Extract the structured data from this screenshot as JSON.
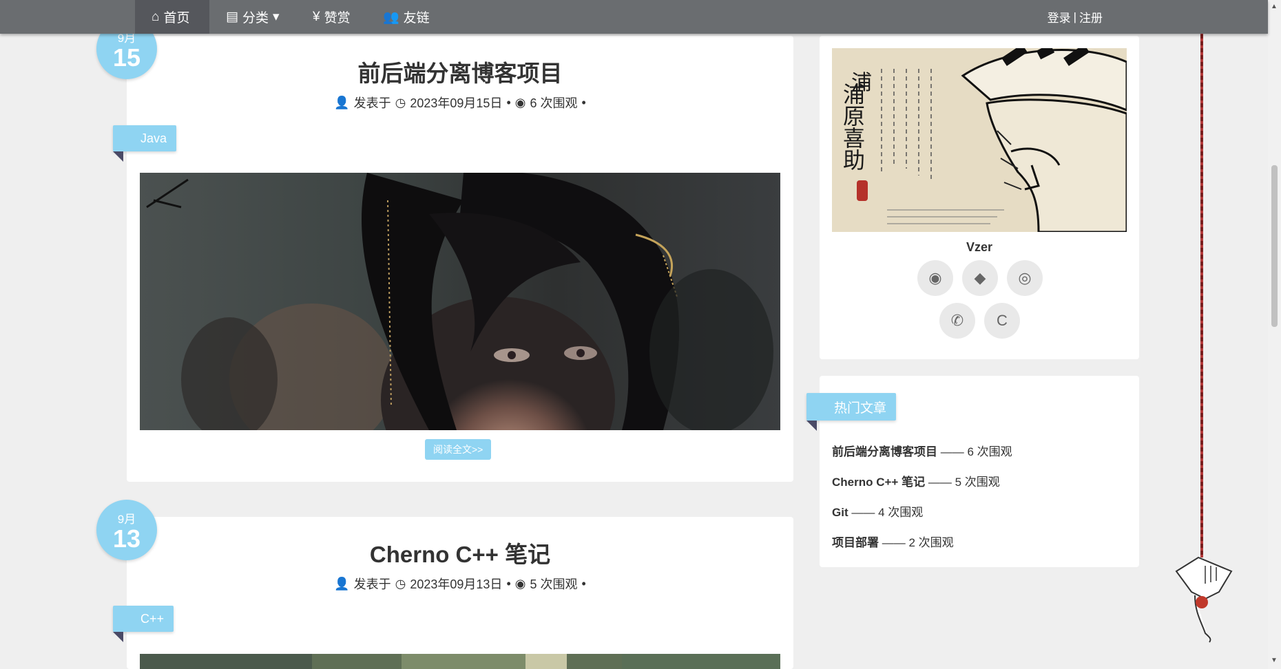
{
  "nav": {
    "items": [
      {
        "icon": "home-icon",
        "glyph": "⌂",
        "label": "首页"
      },
      {
        "icon": "category-icon",
        "glyph": "▤",
        "label": "分类",
        "caret": "▾"
      },
      {
        "icon": "yen-icon",
        "glyph": "¥",
        "label": "赞赏"
      },
      {
        "icon": "users-icon",
        "glyph": "👥",
        "label": "友链"
      }
    ],
    "login": "登录",
    "separator": "|",
    "register": "注册"
  },
  "posts": [
    {
      "month": "9月",
      "day": "15",
      "title": "前后端分离博客项目",
      "author_prefix": "发表于",
      "date": "2023年09月15日",
      "views": "6 次围观",
      "dot": "•",
      "tag": "Java",
      "read_more": "阅读全文>>"
    },
    {
      "month": "9月",
      "day": "13",
      "title": "Cherno C++ 笔记",
      "author_prefix": "发表于",
      "date": "2023年09月13日",
      "views": "5 次围观",
      "dot": "•",
      "tag": "C++"
    }
  ],
  "profile": {
    "name": "Vzer",
    "image_text": "浦原喜助",
    "socials": [
      {
        "icon": "github-icon",
        "glyph": "◉"
      },
      {
        "icon": "qq-icon",
        "glyph": "◆"
      },
      {
        "icon": "weibo-icon",
        "glyph": "◎"
      },
      {
        "icon": "wechat-icon",
        "glyph": "✆"
      },
      {
        "icon": "csdn-icon",
        "glyph": "C"
      }
    ]
  },
  "hot": {
    "title": "热门文章",
    "items": [
      {
        "name": "前后端分离博客项目",
        "sep": "——",
        "views": "6 次围观"
      },
      {
        "name": "Cherno C++ 笔记",
        "sep": "——",
        "views": "5 次围观"
      },
      {
        "name": "Git",
        "sep": "——",
        "views": "4 次围观"
      },
      {
        "name": "项目部署",
        "sep": "——",
        "views": "2 次围观"
      }
    ]
  },
  "colors": {
    "accent": "#8fd4f2",
    "nav_bg": "#6a6d70",
    "tag_fold": "#4a4a66"
  }
}
